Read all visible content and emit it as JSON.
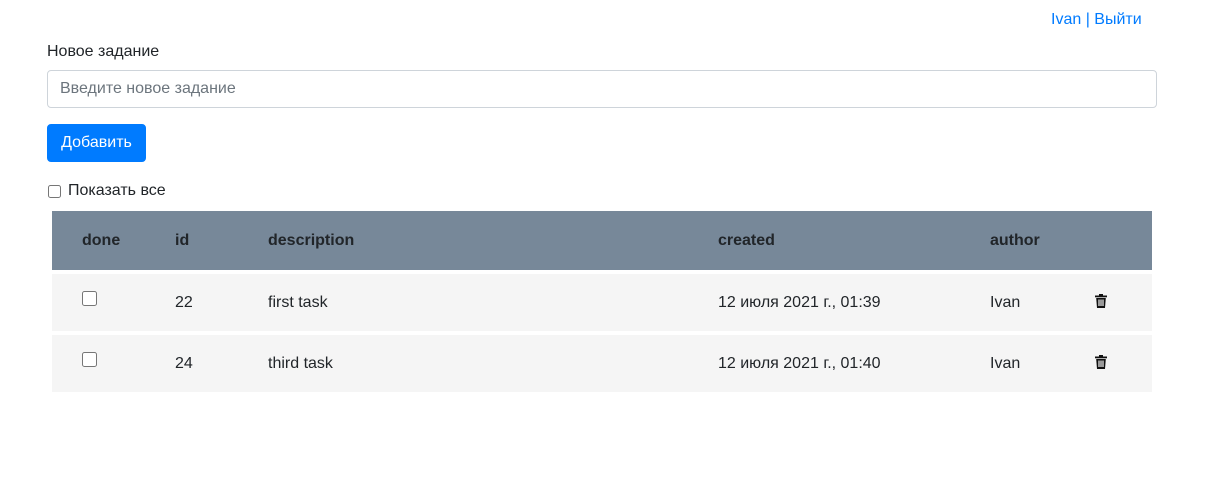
{
  "header": {
    "username": "Ivan",
    "separator": " | ",
    "logout_label": "Выйти"
  },
  "new_task": {
    "label": "Новое задание",
    "placeholder": "Введите новое задание",
    "value": "",
    "add_button_label": "Добавить"
  },
  "filter": {
    "show_all_label": "Показать все",
    "show_all_checked": false
  },
  "table": {
    "columns": {
      "done": "done",
      "id": "id",
      "description": "description",
      "created": "created",
      "author": "author"
    },
    "rows": [
      {
        "done": false,
        "id": "22",
        "description": "first task",
        "created": "12 июля 2021 г., 01:39",
        "author": "Ivan",
        "delete_icon": "trash-icon"
      },
      {
        "done": false,
        "id": "24",
        "description": "third task",
        "created": "12 июля 2021 г., 01:40",
        "author": "Ivan",
        "delete_icon": "trash-icon"
      }
    ]
  },
  "colors": {
    "link": "#007bff",
    "primary_button": "#007bff",
    "table_header_bg": "#778899",
    "table_row_bg": "#f5f5f5"
  }
}
